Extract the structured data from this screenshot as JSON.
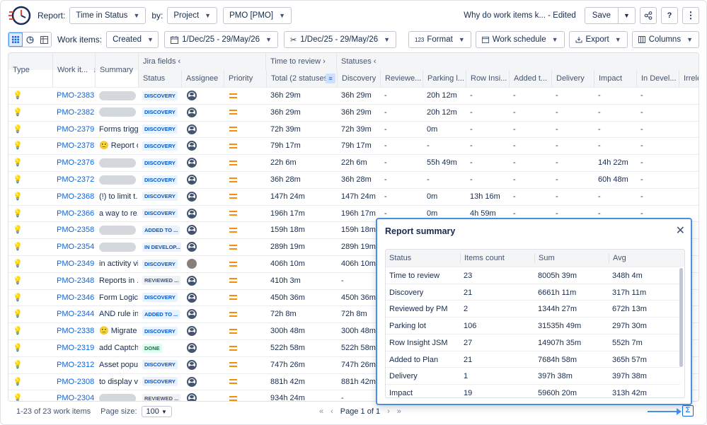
{
  "topbar": {
    "report_label": "Report:",
    "report_value": "Time in Status",
    "by_label": "by:",
    "by_value": "Project",
    "project_value": "PMO [PMO]",
    "title": "Why do work items k... - Edited",
    "save_label": "Save"
  },
  "toolbar": {
    "workitems_label": "Work items:",
    "created_value": "Created",
    "date_range_1": "1/Dec/25 - 29/May/26",
    "date_range_2": "1/Dec/25 - 29/May/26",
    "format_label": "Format",
    "format_prefix": "123",
    "schedule_label": "Work schedule",
    "export_label": "Export",
    "columns_label": "Columns"
  },
  "table": {
    "groups": {
      "jira_fields": "Jira fields",
      "time_to_review": "Time to review",
      "statuses": "Statuses"
    },
    "headers": {
      "type": "Type",
      "work_item": "Work it...",
      "summary": "Summary",
      "status": "Status",
      "assignee": "Assignee",
      "priority": "Priority",
      "total": "Total (2 statuses)",
      "discovery": "Discovery",
      "reviewed": "Reviewe...",
      "parking": "Parking l...",
      "rowinsight": "Row Insi...",
      "added": "Added t...",
      "delivery": "Delivery",
      "impact": "Impact",
      "indevel": "In Devel...",
      "irrelev": "Irrelev"
    },
    "rows": [
      {
        "key": "PMO-2383",
        "summary": "",
        "status": "DISCOVERY",
        "status_color": "blue",
        "assignee": "avatar",
        "total": "36h 29m",
        "discovery": "36h 29m",
        "reviewed": "-",
        "parking": "20h 12m",
        "rowinsight": "-",
        "added": "-",
        "delivery": "-",
        "impact": "-",
        "indevel": "-"
      },
      {
        "key": "PMO-2382",
        "summary": "",
        "status": "DISCOVERY",
        "status_color": "blue",
        "assignee": "avatar",
        "total": "36h 29m",
        "discovery": "36h 29m",
        "reviewed": "-",
        "parking": "20h 12m",
        "rowinsight": "-",
        "added": "-",
        "delivery": "-",
        "impact": "-",
        "indevel": "-"
      },
      {
        "key": "PMO-2379",
        "summary": "Forms trigg...",
        "status": "DISCOVERY",
        "status_color": "blue",
        "assignee": "avatar",
        "total": "72h 39m",
        "discovery": "72h 39m",
        "reviewed": "-",
        "parking": "0m",
        "rowinsight": "-",
        "added": "-",
        "delivery": "-",
        "impact": "-",
        "indevel": "-"
      },
      {
        "key": "PMO-2378",
        "summary": "🙂 Report o...",
        "status": "DISCOVERY",
        "status_color": "blue",
        "assignee": "avatar",
        "total": "79h 17m",
        "discovery": "79h 17m",
        "reviewed": "-",
        "parking": "-",
        "rowinsight": "-",
        "added": "-",
        "delivery": "-",
        "impact": "-",
        "indevel": "-"
      },
      {
        "key": "PMO-2376",
        "summary": "",
        "status": "DISCOVERY",
        "status_color": "blue",
        "assignee": "avatar",
        "total": "22h 6m",
        "discovery": "22h 6m",
        "reviewed": "-",
        "parking": "55h 49m",
        "rowinsight": "-",
        "added": "-",
        "delivery": "-",
        "impact": "14h 22m",
        "indevel": "-"
      },
      {
        "key": "PMO-2372",
        "summary": "",
        "status": "DISCOVERY",
        "status_color": "blue",
        "assignee": "avatar",
        "total": "36h 28m",
        "discovery": "36h 28m",
        "reviewed": "-",
        "parking": "-",
        "rowinsight": "-",
        "added": "-",
        "delivery": "-",
        "impact": "60h 48m",
        "indevel": "-"
      },
      {
        "key": "PMO-2368",
        "summary": "(!) to limit t...",
        "status": "DISCOVERY",
        "status_color": "blue",
        "assignee": "avatar",
        "total": "147h 24m",
        "discovery": "147h 24m",
        "reviewed": "-",
        "parking": "0m",
        "rowinsight": "13h 16m",
        "added": "-",
        "delivery": "-",
        "impact": "-",
        "indevel": "-"
      },
      {
        "key": "PMO-2366",
        "summary": "a way to re...",
        "status": "DISCOVERY",
        "status_color": "blue",
        "assignee": "avatar",
        "total": "196h 17m",
        "discovery": "196h 17m",
        "reviewed": "-",
        "parking": "0m",
        "rowinsight": "4h 59m",
        "added": "-",
        "delivery": "-",
        "impact": "-",
        "indevel": "-"
      },
      {
        "key": "PMO-2358",
        "summary": "",
        "status": "ADDED TO ...",
        "status_color": "blue",
        "assignee": "avatar",
        "total": "159h 18m",
        "discovery": "159h 18m",
        "reviewed": "",
        "parking": "",
        "rowinsight": "",
        "added": "",
        "delivery": "",
        "impact": "",
        "indevel": ""
      },
      {
        "key": "PMO-2354",
        "summary": "",
        "status": "IN DEVELOP...",
        "status_color": "blue",
        "assignee": "avatar",
        "total": "289h 19m",
        "discovery": "289h 19m",
        "reviewed": "",
        "parking": "",
        "rowinsight": "",
        "added": "",
        "delivery": "",
        "impact": "",
        "indevel": ""
      },
      {
        "key": "PMO-2349",
        "summary": "in activity vi...",
        "status": "DISCOVERY",
        "status_color": "blue",
        "assignee": "photo",
        "total": "406h 10m",
        "discovery": "406h 10m",
        "reviewed": "",
        "parking": "",
        "rowinsight": "",
        "added": "",
        "delivery": "",
        "impact": "",
        "indevel": ""
      },
      {
        "key": "PMO-2348",
        "summary": "Reports in ...",
        "status": "REVIEWED ...",
        "status_color": "gray",
        "assignee": "avatar",
        "total": "410h 3m",
        "discovery": "-",
        "reviewed": "",
        "parking": "",
        "rowinsight": "",
        "added": "",
        "delivery": "",
        "impact": "",
        "indevel": ""
      },
      {
        "key": "PMO-2346",
        "summary": "Form Logic...",
        "status": "DISCOVERY",
        "status_color": "blue",
        "assignee": "avatar",
        "total": "450h 36m",
        "discovery": "450h 36m",
        "reviewed": "",
        "parking": "",
        "rowinsight": "",
        "added": "",
        "delivery": "",
        "impact": "",
        "indevel": ""
      },
      {
        "key": "PMO-2344",
        "summary": "AND rule in...",
        "status": "ADDED TO ...",
        "status_color": "blue",
        "assignee": "avatar",
        "total": "72h 8m",
        "discovery": "72h 8m",
        "reviewed": "",
        "parking": "",
        "rowinsight": "",
        "added": "",
        "delivery": "",
        "impact": "",
        "indevel": ""
      },
      {
        "key": "PMO-2338",
        "summary": "🙂 Migrate ...",
        "status": "DISCOVERY",
        "status_color": "blue",
        "assignee": "avatar",
        "total": "300h 48m",
        "discovery": "300h 48m",
        "reviewed": "",
        "parking": "",
        "rowinsight": "",
        "added": "",
        "delivery": "",
        "impact": "",
        "indevel": ""
      },
      {
        "key": "PMO-2319",
        "summary": "add Captch...",
        "status": "DONE",
        "status_color": "green",
        "assignee": "avatar",
        "total": "522h 58m",
        "discovery": "522h 58m",
        "reviewed": "",
        "parking": "",
        "rowinsight": "",
        "added": "",
        "delivery": "",
        "impact": "",
        "indevel": ""
      },
      {
        "key": "PMO-2312",
        "summary": "Asset popu...",
        "status": "DISCOVERY",
        "status_color": "blue",
        "assignee": "avatar",
        "total": "747h 26m",
        "discovery": "747h 26m",
        "reviewed": "",
        "parking": "",
        "rowinsight": "",
        "added": "",
        "delivery": "",
        "impact": "",
        "indevel": ""
      },
      {
        "key": "PMO-2308",
        "summary": "to display v...",
        "status": "DISCOVERY",
        "status_color": "blue",
        "assignee": "avatar",
        "total": "881h 42m",
        "discovery": "881h 42m",
        "reviewed": "",
        "parking": "",
        "rowinsight": "",
        "added": "",
        "delivery": "",
        "impact": "",
        "indevel": ""
      },
      {
        "key": "PMO-2304",
        "summary": "",
        "status": "REVIEWED ...",
        "status_color": "gray",
        "assignee": "avatar",
        "total": "934h 24m",
        "discovery": "-",
        "reviewed": "",
        "parking": "",
        "rowinsight": "",
        "added": "",
        "delivery": "",
        "impact": "",
        "indevel": ""
      }
    ]
  },
  "footer": {
    "count": "1-23 of 23 work items",
    "page_size_label": "Page size:",
    "page_size_value": "100",
    "page_label": "Page 1 of 1"
  },
  "summary": {
    "title": "Report summary",
    "headers": {
      "status": "Status",
      "count": "Items count",
      "sum": "Sum",
      "avg": "Avg"
    },
    "rows": [
      {
        "status": "Time to review",
        "count": "23",
        "sum": "8005h 39m",
        "avg": "348h 4m"
      },
      {
        "status": "Discovery",
        "count": "21",
        "sum": "6661h 11m",
        "avg": "317h 11m"
      },
      {
        "status": "Reviewed by PM",
        "count": "2",
        "sum": "1344h 27m",
        "avg": "672h 13m"
      },
      {
        "status": "Parking lot",
        "count": "106",
        "sum": "31535h 49m",
        "avg": "297h 30m"
      },
      {
        "status": "Row Insight JSM",
        "count": "27",
        "sum": "14907h 35m",
        "avg": "552h 7m"
      },
      {
        "status": "Added to Plan",
        "count": "21",
        "sum": "7684h 58m",
        "avg": "365h 57m"
      },
      {
        "status": "Delivery",
        "count": "1",
        "sum": "397h 38m",
        "avg": "397h 38m"
      },
      {
        "status": "Impact",
        "count": "19",
        "sum": "5960h 20m",
        "avg": "313h 42m"
      }
    ]
  }
}
